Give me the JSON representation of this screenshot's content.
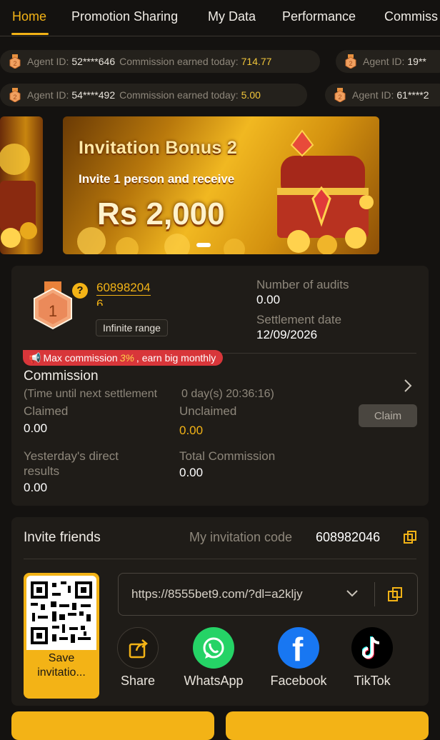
{
  "tabs": [
    {
      "label": "Home"
    },
    {
      "label": "Promotion Sharing"
    },
    {
      "label": "My Data"
    },
    {
      "label": "Performance"
    },
    {
      "label": "Commiss"
    }
  ],
  "tickers": [
    {
      "agent_label": "Agent ID:",
      "agent_id": "52****646",
      "commission_label": "Commission earned today:",
      "amount": "714.77"
    },
    {
      "agent_label": "Agent ID:",
      "agent_id": "19**",
      "commission_label": "",
      "amount": ""
    },
    {
      "agent_label": "Agent ID:",
      "agent_id": "54****492",
      "commission_label": "Commission earned today:",
      "amount": "5.00"
    },
    {
      "agent_label": "Agent ID:",
      "agent_id": "61****2",
      "commission_label": "",
      "amount": ""
    }
  ],
  "banner": {
    "title": "Invitation Bonus 2",
    "subtitle": "Invite 1 person and receive",
    "amount": "Rs 2,000"
  },
  "agent": {
    "level": "1",
    "help_icon": "?",
    "id_line1": "60898204",
    "id_line2": "6",
    "range": "Infinite range",
    "audits_label": "Number of audits",
    "audits_value": "0.00",
    "settlement_label": "Settlement date",
    "settlement_value": "12/09/2026"
  },
  "promo_pill": {
    "prefix": "Max commission",
    "percent": "3%",
    "suffix": ", earn big monthly"
  },
  "commission": {
    "title": "Commission",
    "countdown_label": "(Time until next settlement",
    "countdown_value": "0 day(s) 20:36:16)",
    "claimed_label": "Claimed",
    "claimed_value": "0.00",
    "unclaimed_label": "Unclaimed",
    "unclaimed_value": "0.00",
    "claim_button": "Claim",
    "yesterday_label_1": "Yesterday's direct",
    "yesterday_label_2": "results",
    "yesterday_value": "0.00",
    "total_label": "Total Commission",
    "total_value": "0.00"
  },
  "invite": {
    "title": "Invite friends",
    "code_label": "My invitation code",
    "code": "608982046",
    "save_line1": "Save",
    "save_line2": "invitatio...",
    "url": "https://8555bet9.com/?dl=a2kljy"
  },
  "share": [
    {
      "label": "Share",
      "icon": "share-icon"
    },
    {
      "label": "WhatsApp",
      "icon": "whatsapp-icon"
    },
    {
      "label": "Facebook",
      "icon": "facebook-icon"
    },
    {
      "label": "TikTok",
      "icon": "tiktok-icon"
    }
  ],
  "colors": {
    "accent": "#f3b316",
    "background": "#141210",
    "card": "#1f1c18",
    "promo": "#d8363a"
  }
}
